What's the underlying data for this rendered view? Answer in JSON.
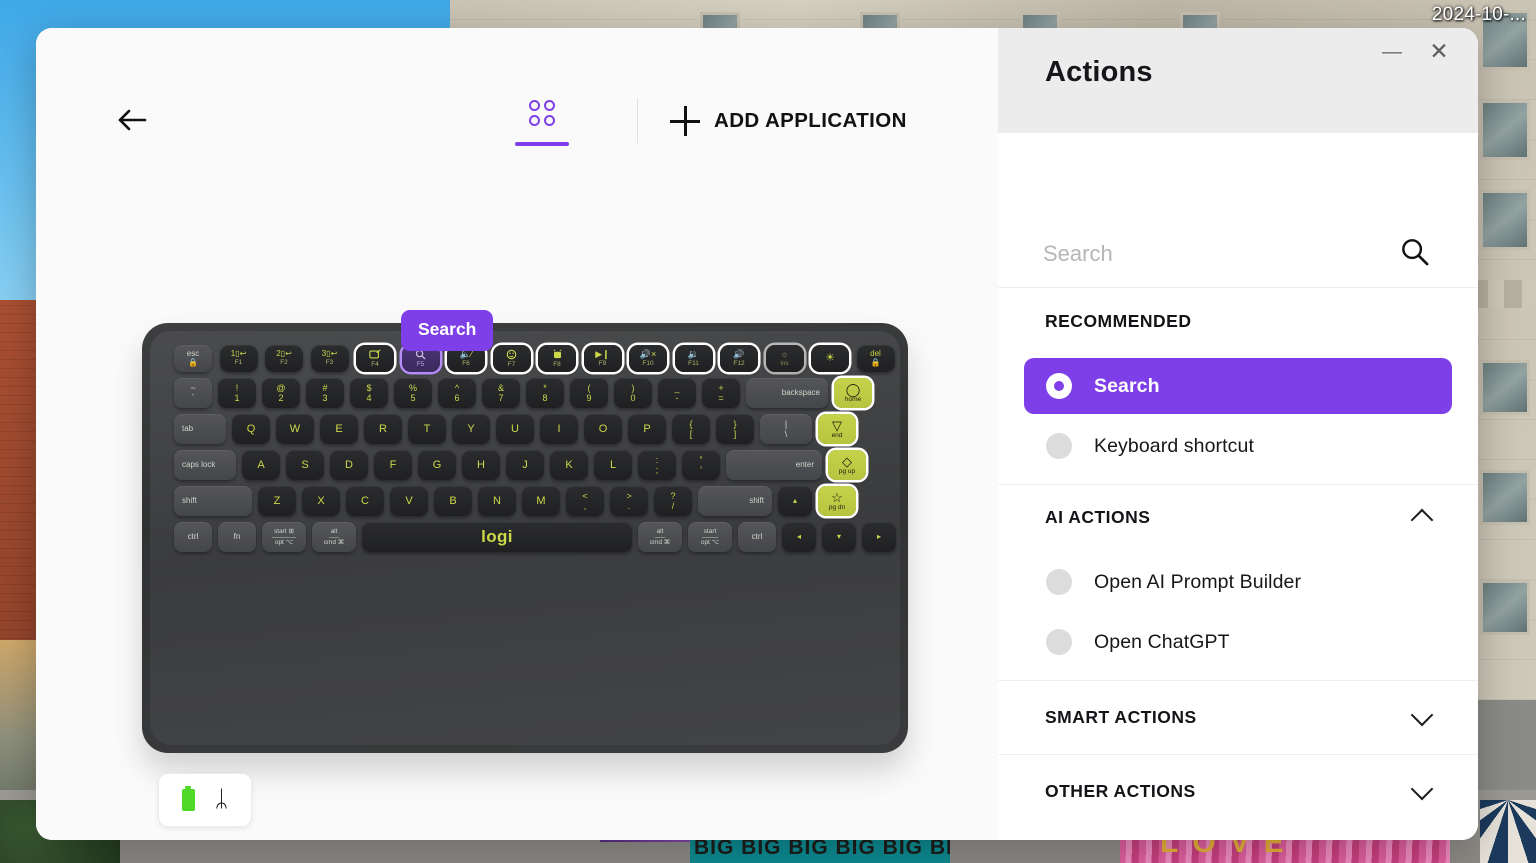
{
  "desktop": {
    "timestamp": "2024-10-...",
    "street_art_big": "BIG BIG BIG BIG BIG BIG BI",
    "street_art_love": "LOVE"
  },
  "window": {
    "minimize_glyph": "—",
    "close_glyph": "✕"
  },
  "toolbar": {
    "back_label": "Back",
    "devices_tab_label": "Devices",
    "add_application_label": "ADD APPLICATION"
  },
  "keyboard": {
    "tooltip": "Search",
    "brand": "logi",
    "rows": [
      {
        "id": "function-row",
        "keys": [
          {
            "top": "esc",
            "bot": "🔒",
            "style": "light"
          },
          {
            "top": "1⬛↩",
            "fn": "F1"
          },
          {
            "top": "2⬛↩",
            "fn": "F2"
          },
          {
            "top": "3⬛↩",
            "fn": "F3"
          },
          {
            "glyph": "dictate",
            "fn": "F4",
            "ring": "white"
          },
          {
            "glyph": "search",
            "fn": "F5",
            "ring": "purple",
            "selected": true
          },
          {
            "glyph": "mic-off",
            "fn": "F6",
            "ring": "white"
          },
          {
            "glyph": "emoji",
            "fn": "F7",
            "ring": "white"
          },
          {
            "glyph": "snip",
            "fn": "F8",
            "ring": "white"
          },
          {
            "glyph": "play-pause",
            "fn": "F9",
            "ring": "white"
          },
          {
            "glyph": "mute",
            "fn": "F10",
            "ring": "white"
          },
          {
            "glyph": "vol-down",
            "fn": "F11",
            "ring": "white"
          },
          {
            "glyph": "vol-up",
            "fn": "F12",
            "ring": "white"
          },
          {
            "glyph": "brightness-down",
            "fn": "ins",
            "ring": "white-dim"
          },
          {
            "glyph": "brightness-up",
            "fn": "",
            "ring": "white"
          },
          {
            "top": "del",
            "bot": "🔒"
          }
        ]
      },
      {
        "id": "number-row",
        "keys": [
          {
            "top": "~",
            "bot": "`",
            "style": "light"
          },
          {
            "top": "!",
            "bot": "1"
          },
          {
            "top": "@",
            "bot": "2"
          },
          {
            "top": "#",
            "bot": "3"
          },
          {
            "top": "$",
            "bot": "4"
          },
          {
            "top": "%",
            "bot": "5"
          },
          {
            "top": "^",
            "bot": "6"
          },
          {
            "top": "&",
            "bot": "7"
          },
          {
            "top": "*",
            "bot": "8"
          },
          {
            "top": "(",
            "bot": "9"
          },
          {
            "top": ")",
            "bot": "0"
          },
          {
            "top": "_",
            "bot": "-"
          },
          {
            "top": "+",
            "bot": "="
          },
          {
            "top": "backspace",
            "width": "w-bks",
            "style": "light",
            "align": "right"
          },
          {
            "glyph": "circle",
            "bot": "home",
            "style": "lime"
          }
        ]
      },
      {
        "id": "qwerty-row",
        "keys": [
          {
            "top": "tab",
            "width": "w-tab",
            "style": "light"
          },
          {
            "top": "Q"
          },
          {
            "top": "W"
          },
          {
            "top": "E"
          },
          {
            "top": "R"
          },
          {
            "top": "T"
          },
          {
            "top": "Y"
          },
          {
            "top": "U"
          },
          {
            "top": "I"
          },
          {
            "top": "O"
          },
          {
            "top": "P"
          },
          {
            "top": "{",
            "bot": "["
          },
          {
            "top": "}",
            "bot": "]"
          },
          {
            "top": "|",
            "bot": "\\",
            "width": "w-bsl",
            "style": "light"
          },
          {
            "glyph": "triangle",
            "bot": "end",
            "style": "lime"
          }
        ]
      },
      {
        "id": "home-row",
        "keys": [
          {
            "top": "caps lock",
            "width": "w-caps",
            "style": "light"
          },
          {
            "top": "A"
          },
          {
            "top": "S"
          },
          {
            "top": "D"
          },
          {
            "top": "F"
          },
          {
            "top": "G"
          },
          {
            "top": "H"
          },
          {
            "top": "J"
          },
          {
            "top": "K"
          },
          {
            "top": "L"
          },
          {
            "top": ":",
            "bot": ";"
          },
          {
            "top": "”",
            "bot": "’"
          },
          {
            "top": "enter",
            "width": "w-ent",
            "style": "light",
            "align": "right"
          },
          {
            "glyph": "diamond",
            "bot": "pg up",
            "style": "lime"
          }
        ]
      },
      {
        "id": "shift-row",
        "keys": [
          {
            "top": "shift",
            "width": "w-shift",
            "style": "light"
          },
          {
            "top": "Z"
          },
          {
            "top": "X"
          },
          {
            "top": "C"
          },
          {
            "top": "V"
          },
          {
            "top": "B"
          },
          {
            "top": "N"
          },
          {
            "top": "M"
          },
          {
            "top": "<",
            "bot": ","
          },
          {
            "top": ">",
            "bot": "."
          },
          {
            "top": "?",
            "bot": "/"
          },
          {
            "top": "shift",
            "width": "w-shiftr",
            "style": "light",
            "align": "right"
          },
          {
            "glyph": "▴",
            "width": "w-arrow"
          },
          {
            "glyph": "star",
            "bot": "pg dn",
            "style": "lime"
          }
        ]
      },
      {
        "id": "bottom-row",
        "keys": [
          {
            "top": "ctrl",
            "style": "light"
          },
          {
            "top": "fn",
            "style": "light"
          },
          {
            "modtop": "start ⊞",
            "modbot": "opt ⌥",
            "width": "w-mod",
            "style": "light"
          },
          {
            "modtop": "alt",
            "modbot": "cmd ⌘",
            "width": "w-mod",
            "style": "light"
          },
          {
            "top": "logi",
            "width": "w-space",
            "brand": true
          },
          {
            "modtop": "alt",
            "modbot": "cmd ⌘",
            "width": "w-mod",
            "style": "light"
          },
          {
            "modtop": "start",
            "modbot": "opt ⌥",
            "width": "w-mod",
            "style": "light"
          },
          {
            "top": "ctrl",
            "style": "light"
          },
          {
            "glyph": "◂",
            "width": "w-arrow"
          },
          {
            "glyph": "▾",
            "width": "w-arrow"
          },
          {
            "glyph": "▸",
            "width": "w-arrow"
          }
        ]
      }
    ]
  },
  "status": {
    "battery_label": "Battery",
    "bluetooth_glyph": "ᛦ"
  },
  "actions": {
    "title": "Actions",
    "search": {
      "value": "",
      "placeholder": "Search"
    },
    "sections": [
      {
        "id": "recommended",
        "title": "RECOMMENDED",
        "collapsible": false,
        "expanded": true,
        "items": [
          {
            "label": "Search",
            "selected": true
          },
          {
            "label": "Keyboard shortcut",
            "selected": false
          }
        ]
      },
      {
        "id": "ai-actions",
        "title": "AI ACTIONS",
        "collapsible": true,
        "expanded": true,
        "items": [
          {
            "label": "Open AI Prompt Builder",
            "selected": false
          },
          {
            "label": "Open ChatGPT",
            "selected": false
          }
        ]
      },
      {
        "id": "smart-actions",
        "title": "SMART ACTIONS",
        "collapsible": true,
        "expanded": false,
        "items": []
      },
      {
        "id": "other-actions",
        "title": "OTHER ACTIONS",
        "collapsible": true,
        "expanded": false,
        "items": []
      }
    ]
  },
  "colors": {
    "accent_purple": "#7F3FE8",
    "key_lime": "#C5D24A",
    "key_text": "#CCD84A",
    "battery_green": "#4FD827"
  }
}
